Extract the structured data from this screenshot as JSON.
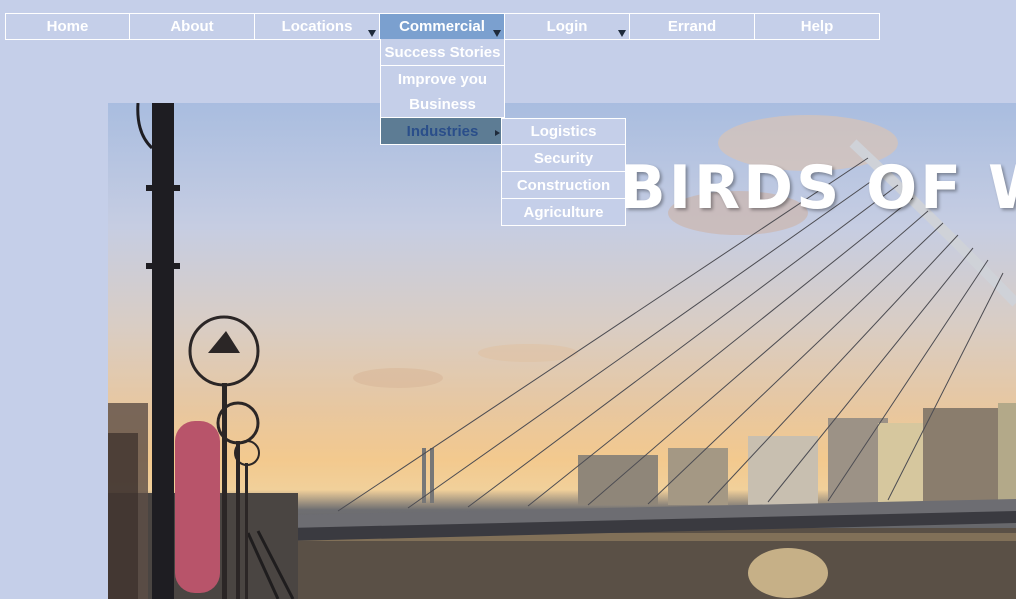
{
  "nav": {
    "items": [
      {
        "label": "Home",
        "has_submenu": false
      },
      {
        "label": "About",
        "has_submenu": false
      },
      {
        "label": "Locations",
        "has_submenu": true
      },
      {
        "label": "Commercial",
        "has_submenu": true,
        "active": true
      },
      {
        "label": "Login",
        "has_submenu": true
      },
      {
        "label": "Errand",
        "has_submenu": false
      },
      {
        "label": "Help",
        "has_submenu": false
      }
    ]
  },
  "commercial_menu": {
    "items": [
      "Success Stories",
      "Improve you Business",
      "Industries"
    ]
  },
  "industries_menu": {
    "items": [
      "Logistics",
      "Security",
      "Construction",
      "Agriculture"
    ]
  },
  "hero": {
    "title": "BIRDS OF W"
  },
  "colors": {
    "background": "#c5cfe9",
    "active_nav": "#7ba0cf",
    "selected_menu": "#5d7c94",
    "border": "#ffffff"
  }
}
